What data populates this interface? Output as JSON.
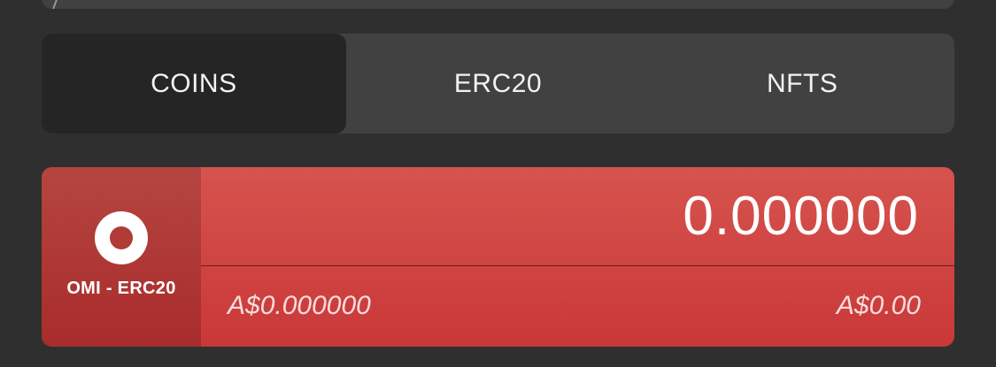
{
  "tabs": [
    {
      "label": "COINS",
      "active": true
    },
    {
      "label": "ERC20",
      "active": false
    },
    {
      "label": "NFTS",
      "active": false
    }
  ],
  "asset_card": {
    "icon": "omi-ring-icon",
    "name": "OMI - ERC20",
    "amount": "0.000000",
    "unit_price": "A$0.000000",
    "total_value": "A$0.00",
    "colors": {
      "card": "#d04545",
      "card_left": "#b03b37",
      "background": "#2f2f2f",
      "tab_bar": "#414141",
      "active_tab": "#252525"
    }
  }
}
